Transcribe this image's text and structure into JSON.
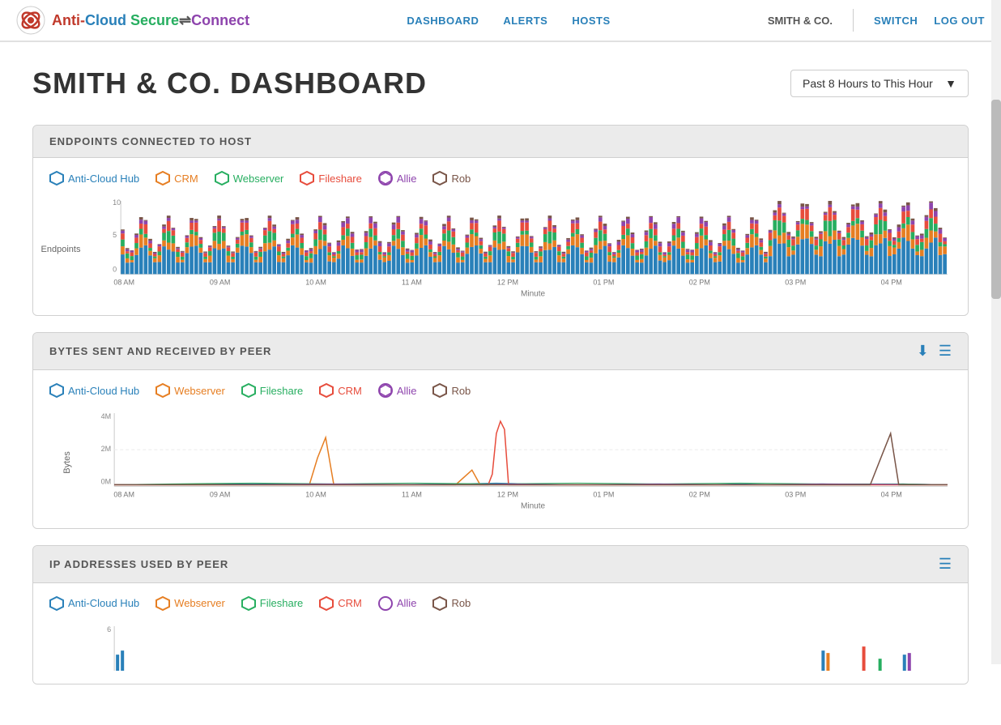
{
  "nav": {
    "logo_text": "Anti-Cloud Secure Connect",
    "links": [
      "DASHBOARD",
      "ALERTS",
      "HOSTS"
    ],
    "org": "SMITH & CO.",
    "right_links": [
      "SWITCH",
      "LOG OUT"
    ]
  },
  "page": {
    "title": "SMITH & CO. DASHBOARD",
    "time_filter": "Past 8 Hours to This Hour"
  },
  "panels": [
    {
      "id": "endpoints",
      "title": "ENDPOINTS CONNECTED TO HOST",
      "legend": [
        {
          "label": "Anti-Cloud Hub",
          "color": "#2980b9"
        },
        {
          "label": "CRM",
          "color": "#e67e22"
        },
        {
          "label": "Webserver",
          "color": "#27ae60"
        },
        {
          "label": "Fileshare",
          "color": "#e74c3c"
        },
        {
          "label": "Allie",
          "color": "#8e44ad"
        },
        {
          "label": "Rob",
          "color": "#795548"
        }
      ],
      "y_label": "Endpoints",
      "x_label": "Minute",
      "x_ticks": [
        "08 AM",
        "09 AM",
        "10 AM",
        "11 AM",
        "12 PM",
        "01 PM",
        "02 PM",
        "03 PM",
        "04 PM"
      ],
      "y_max": 10
    },
    {
      "id": "bytes",
      "title": "BYTES SENT AND RECEIVED BY PEER",
      "legend": [
        {
          "label": "Anti-Cloud Hub",
          "color": "#2980b9"
        },
        {
          "label": "Webserver",
          "color": "#e67e22"
        },
        {
          "label": "Fileshare",
          "color": "#27ae60"
        },
        {
          "label": "CRM",
          "color": "#e74c3c"
        },
        {
          "label": "Allie",
          "color": "#8e44ad"
        },
        {
          "label": "Rob",
          "color": "#795548"
        }
      ],
      "y_label": "Bytes",
      "x_label": "Minute",
      "x_ticks": [
        "08 AM",
        "09 AM",
        "10 AM",
        "11 AM",
        "12 PM",
        "01 PM",
        "02 PM",
        "03 PM",
        "04 PM"
      ],
      "y_ticks": [
        "4M",
        "2M",
        "0M"
      ],
      "has_icons": true
    },
    {
      "id": "ip",
      "title": "IP ADDRESSES USED BY PEER",
      "legend": [
        {
          "label": "Anti-Cloud Hub",
          "color": "#2980b9"
        },
        {
          "label": "Webserver",
          "color": "#e67e22"
        },
        {
          "label": "Fileshare",
          "color": "#27ae60"
        },
        {
          "label": "CRM",
          "color": "#e74c3c"
        },
        {
          "label": "Allie",
          "color": "#8e44ad"
        },
        {
          "label": "Rob",
          "color": "#795548"
        }
      ],
      "has_icons": true
    }
  ]
}
